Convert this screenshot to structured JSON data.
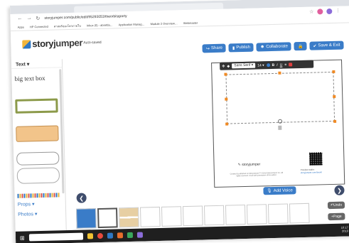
{
  "browser": {
    "url": "storyjumper.com/public/edit/95293053/theorbitaparty",
    "bookmarks": [
      "Apps",
      "HP Connected",
      "ศาสตร์ของโลกภายใน",
      "Inbox (0) - abrefda…",
      "Application Manag…",
      "Module 2 Overview…",
      "Webmaster"
    ]
  },
  "app": {
    "logo_prefix": "story",
    "logo_suffix": "jumper",
    "autosave": "Auto-saved"
  },
  "toolbar": {
    "share": "Share",
    "publish": "Publish",
    "collaborate": "Collaborate",
    "save_exit": "Save & Exit"
  },
  "sidebar": {
    "header": "Text ▾",
    "sample_text": "big text box",
    "props": "Props ▾",
    "photos": "Photos ▾"
  },
  "format_bar": {
    "font": "Sans Serif ▾",
    "size": "14 ▾",
    "bold": "B",
    "italic": "I",
    "underline": "U"
  },
  "page": {
    "footer_logo": "storyjumper",
    "fine_print": "Created & published on StoryJumper™ ©2019 StoryJumper Inc. All rights reserved. Used with permission of the author.",
    "preview_label": "Preview audio:",
    "preview_link": "storyjumper.com/book/"
  },
  "bottom": {
    "add_voice": "Add Voice",
    "undo": "Undo",
    "page": "Page"
  },
  "taskbar": {
    "search_placeholder": "",
    "time": "10:17",
    "date": "2019"
  },
  "colors": {
    "accent": "#3a7cc8",
    "nav_circle": "#3f4d6c",
    "taskbar": "#1f1f1f"
  }
}
